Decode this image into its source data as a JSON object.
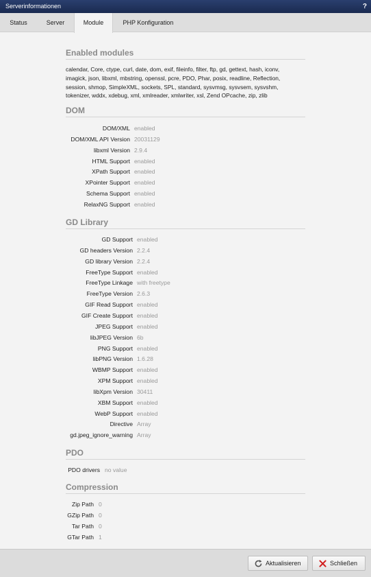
{
  "window": {
    "title": "Serverinformationen",
    "help": "?"
  },
  "tabs": [
    "Status",
    "Server",
    "Module",
    "PHP Konfiguration"
  ],
  "active_tab": "Module",
  "enabled_modules": {
    "heading": "Enabled modules",
    "lines": [
      "calendar, Core, ctype, curl, date, dom, exif, fileinfo, filter, ftp, gd, gettext, hash, iconv,",
      "imagick, json, libxml, mbstring, openssl, pcre, PDO, Phar, posix, readline, Reflection,",
      "session, shmop, SimpleXML, sockets, SPL, standard, sysvmsg, sysvsem, sysvshm,",
      "tokenizer, wddx, xdebug, xml, xmlreader, xmlwriter, xsl, Zend OPcache, zip, zlib"
    ]
  },
  "sections": [
    {
      "heading": "DOM",
      "rows": [
        {
          "k": "DOM/XML",
          "v": "enabled"
        },
        {
          "k": "DOM/XML API Version",
          "v": "20031129"
        },
        {
          "k": "libxml Version",
          "v": "2.9.4"
        },
        {
          "k": "HTML Support",
          "v": "enabled"
        },
        {
          "k": "XPath Support",
          "v": "enabled"
        },
        {
          "k": "XPointer Support",
          "v": "enabled"
        },
        {
          "k": "Schema Support",
          "v": "enabled"
        },
        {
          "k": "RelaxNG Support",
          "v": "enabled"
        }
      ]
    },
    {
      "heading": "GD Library",
      "rows": [
        {
          "k": "GD Support",
          "v": "enabled"
        },
        {
          "k": "GD headers Version",
          "v": "2.2.4"
        },
        {
          "k": "GD library Version",
          "v": "2.2.4"
        },
        {
          "k": "FreeType Support",
          "v": "enabled"
        },
        {
          "k": "FreeType Linkage",
          "v": "with freetype"
        },
        {
          "k": "FreeType Version",
          "v": "2.6.3"
        },
        {
          "k": "GIF Read Support",
          "v": "enabled"
        },
        {
          "k": "GIF Create Support",
          "v": "enabled"
        },
        {
          "k": "JPEG Support",
          "v": "enabled"
        },
        {
          "k": "libJPEG Version",
          "v": "6b"
        },
        {
          "k": "PNG Support",
          "v": "enabled"
        },
        {
          "k": "libPNG Version",
          "v": "1.6.28"
        },
        {
          "k": "WBMP Support",
          "v": "enabled"
        },
        {
          "k": "XPM Support",
          "v": "enabled"
        },
        {
          "k": "libXpm Version",
          "v": "30411"
        },
        {
          "k": "XBM Support",
          "v": "enabled"
        },
        {
          "k": "WebP Support",
          "v": "enabled"
        },
        {
          "k": "Directive",
          "v": "Array"
        },
        {
          "k": "gd.jpeg_ignore_warning",
          "v": "Array"
        }
      ]
    },
    {
      "heading": "PDO",
      "rows": [
        {
          "k": "PDO drivers",
          "v": "no value"
        }
      ]
    },
    {
      "heading": "Compression",
      "rows": [
        {
          "k": "Zip Path",
          "v": "0"
        },
        {
          "k": "GZip Path",
          "v": "0"
        },
        {
          "k": "Tar Path",
          "v": "0"
        },
        {
          "k": "GTar Path",
          "v": "1"
        }
      ]
    }
  ],
  "footer": {
    "refresh_label": "Aktualisieren",
    "close_label": "Schließen"
  },
  "colors": {
    "titlebar": "#1f3160",
    "heading": "#8a8a8a",
    "value": "#999999",
    "close_icon": "#d22020"
  }
}
